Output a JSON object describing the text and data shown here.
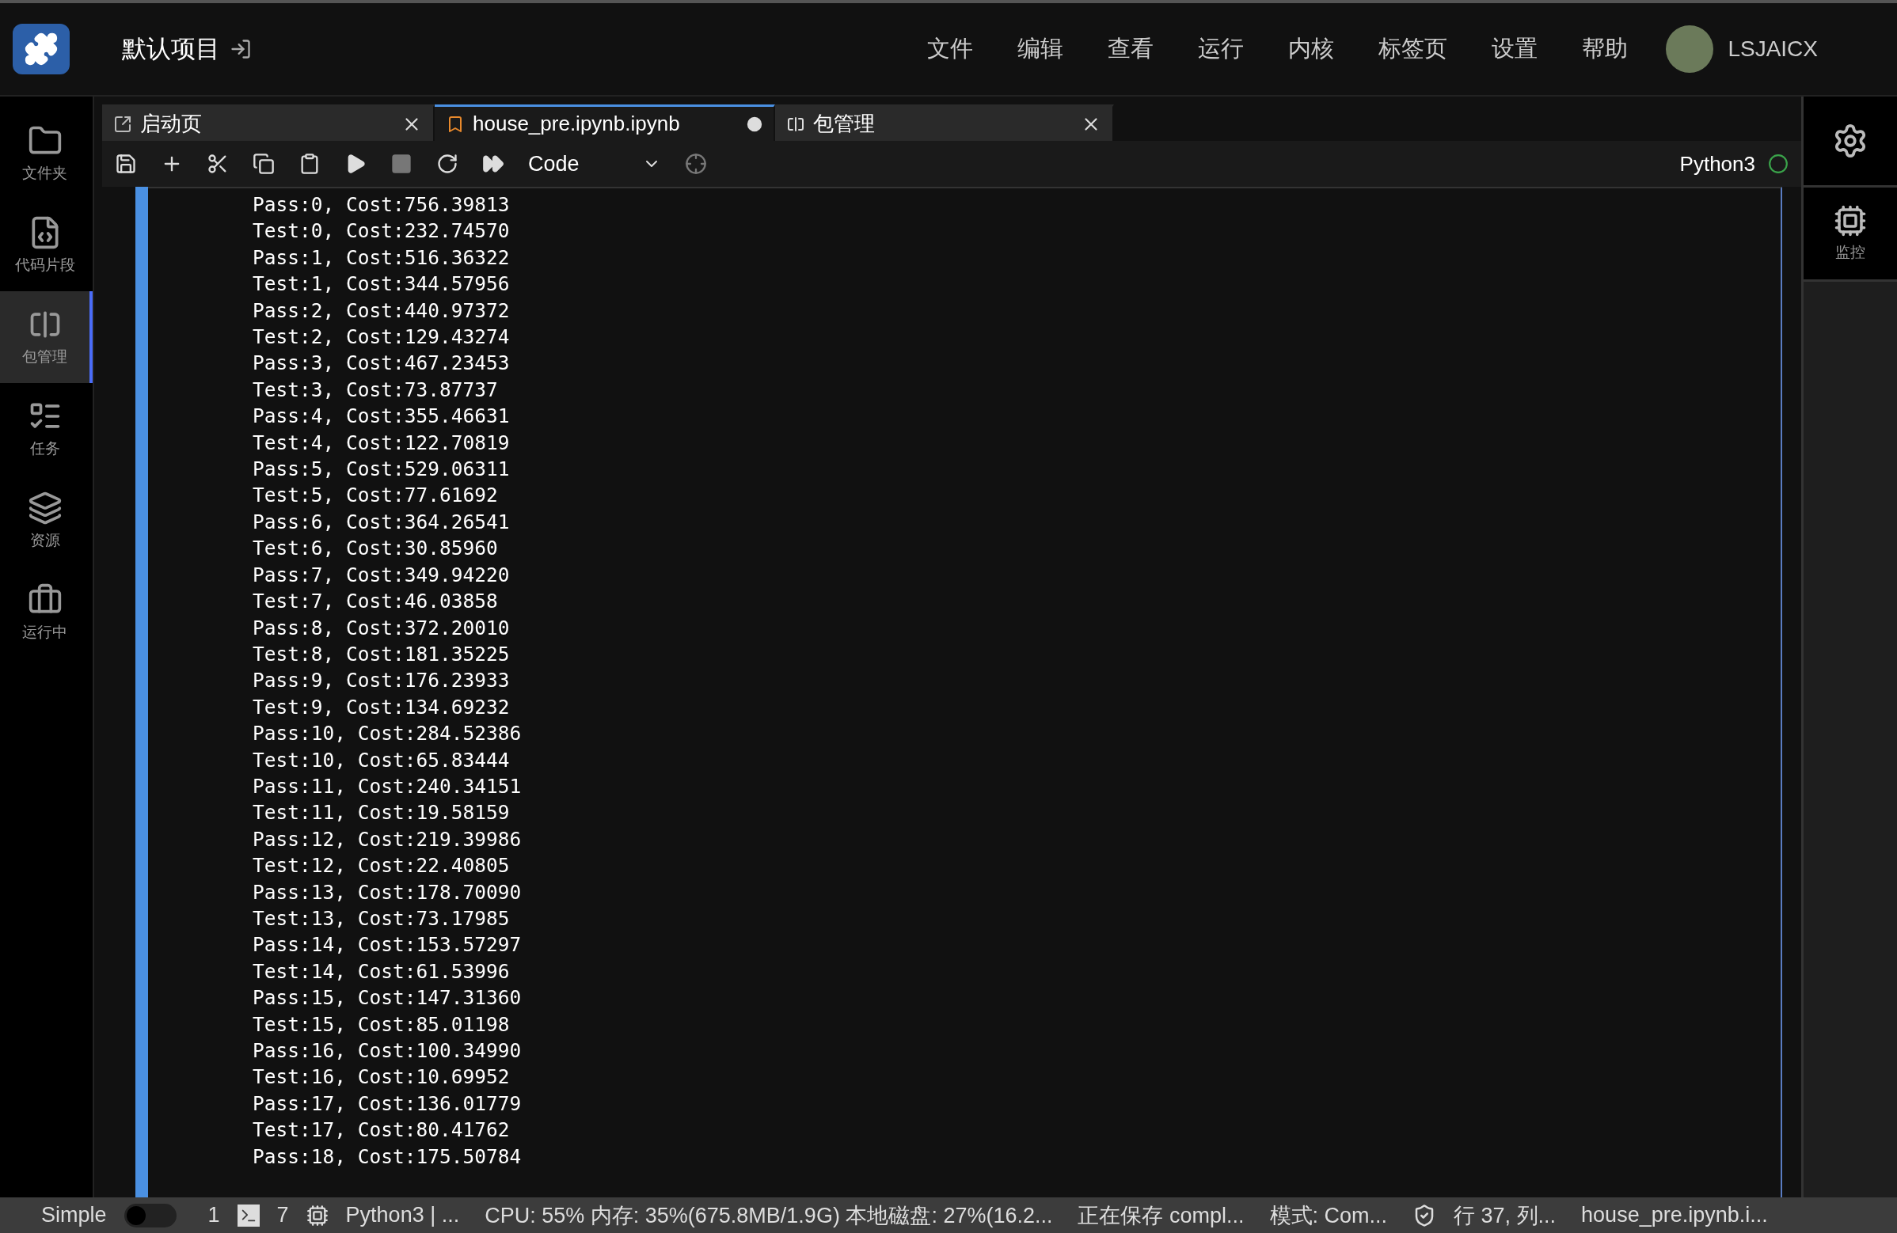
{
  "header": {
    "project": "默认项目",
    "menu": [
      "文件",
      "编辑",
      "查看",
      "运行",
      "内核",
      "标签页",
      "设置",
      "帮助"
    ],
    "user": "LSJAICX"
  },
  "sidebar": {
    "items": [
      {
        "kind": "folder",
        "label": "文件夹",
        "selected": false
      },
      {
        "kind": "snippet",
        "label": "代码片段",
        "selected": false
      },
      {
        "kind": "package",
        "label": "包管理",
        "selected": true
      },
      {
        "kind": "task",
        "label": "任务",
        "selected": false
      },
      {
        "kind": "resource",
        "label": "资源",
        "selected": false
      },
      {
        "kind": "running",
        "label": "运行中",
        "selected": false
      }
    ]
  },
  "tabs": [
    {
      "kind": "launcher",
      "label": "启动页",
      "selected": false,
      "dirty": false
    },
    {
      "kind": "notebook",
      "label": "house_pre.ipynb.ipynb",
      "selected": true,
      "dirty": true
    },
    {
      "kind": "package",
      "label": "包管理",
      "selected": false,
      "dirty": false
    }
  ],
  "toolbar": {
    "cell_type": "Code",
    "kernel": "Python3"
  },
  "output": [
    "Pass:0, Cost:756.39813",
    "Test:0, Cost:232.74570",
    "Pass:1, Cost:516.36322",
    "Test:1, Cost:344.57956",
    "Pass:2, Cost:440.97372",
    "Test:2, Cost:129.43274",
    "Pass:3, Cost:467.23453",
    "Test:3, Cost:73.87737",
    "Pass:4, Cost:355.46631",
    "Test:4, Cost:122.70819",
    "Pass:5, Cost:529.06311",
    "Test:5, Cost:77.61692",
    "Pass:6, Cost:364.26541",
    "Test:6, Cost:30.85960",
    "Pass:7, Cost:349.94220",
    "Test:7, Cost:46.03858",
    "Pass:8, Cost:372.20010",
    "Test:8, Cost:181.35225",
    "Pass:9, Cost:176.23933",
    "Test:9, Cost:134.69232",
    "Pass:10, Cost:284.52386",
    "Test:10, Cost:65.83444",
    "Pass:11, Cost:240.34151",
    "Test:11, Cost:19.58159",
    "Pass:12, Cost:219.39986",
    "Test:12, Cost:22.40805",
    "Pass:13, Cost:178.70090",
    "Test:13, Cost:73.17985",
    "Pass:14, Cost:153.57297",
    "Test:14, Cost:61.53996",
    "Pass:15, Cost:147.31360",
    "Test:15, Cost:85.01198",
    "Pass:16, Cost:100.34990",
    "Test:16, Cost:10.69952",
    "Pass:17, Cost:136.01779",
    "Test:17, Cost:80.41762",
    "Pass:18, Cost:175.50784"
  ],
  "right_panel": {
    "monitor_label": "监控"
  },
  "status_bar": {
    "mode_label": "Simple",
    "simple_on": false,
    "terminals": "1",
    "kernels": "7",
    "kernel": "Python3 | ...",
    "resources": "CPU: 55% 内存: 35%(675.8MB/1.9G) 本地磁盘: 27%(16.2...",
    "saving": "正在保存 compl...",
    "mode": "模式: Com...",
    "position": "行 37, 列...",
    "file": "house_pre.ipynb.i..."
  }
}
